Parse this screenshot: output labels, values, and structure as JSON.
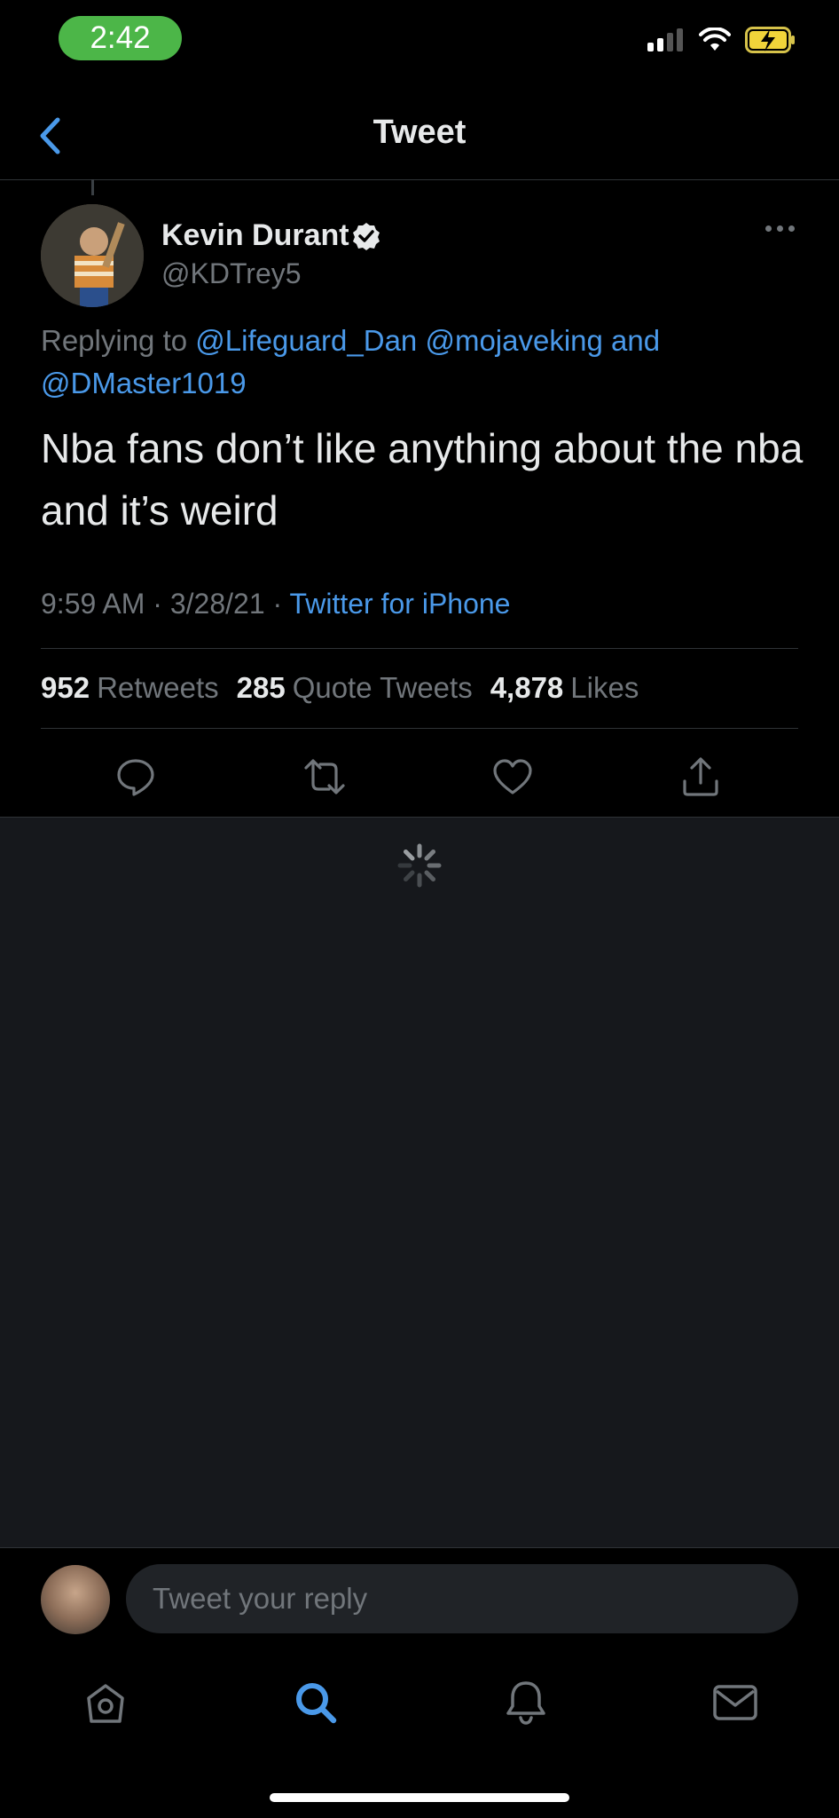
{
  "status_bar": {
    "time": "2:42"
  },
  "header": {
    "title": "Tweet"
  },
  "tweet": {
    "author_name": "Kevin Durant",
    "author_handle": "@KDTrey5",
    "replying_prefix": "Replying to",
    "replying_mentions": [
      "@Lifeguard_Dan",
      "@mojaveking",
      "and",
      "@DMaster1019"
    ],
    "text": "Nba fans don’t like anything about the nba and it’s weird",
    "time": "9:59 AM",
    "date": "3/28/21",
    "source": "Twitter for iPhone",
    "separator": "·",
    "stats": [
      {
        "count": "952",
        "label": "Retweets"
      },
      {
        "count": "285",
        "label": "Quote Tweets"
      },
      {
        "count": "4,878",
        "label": "Likes"
      }
    ]
  },
  "composer": {
    "placeholder": "Tweet your reply"
  },
  "tab_bar": [
    "home-icon",
    "search-icon",
    "bell-icon",
    "mail-icon"
  ],
  "colors": {
    "accent": "#4a99e9",
    "background": "#000000",
    "replies_bg": "#16181c",
    "status_pill": "#4cb648"
  }
}
